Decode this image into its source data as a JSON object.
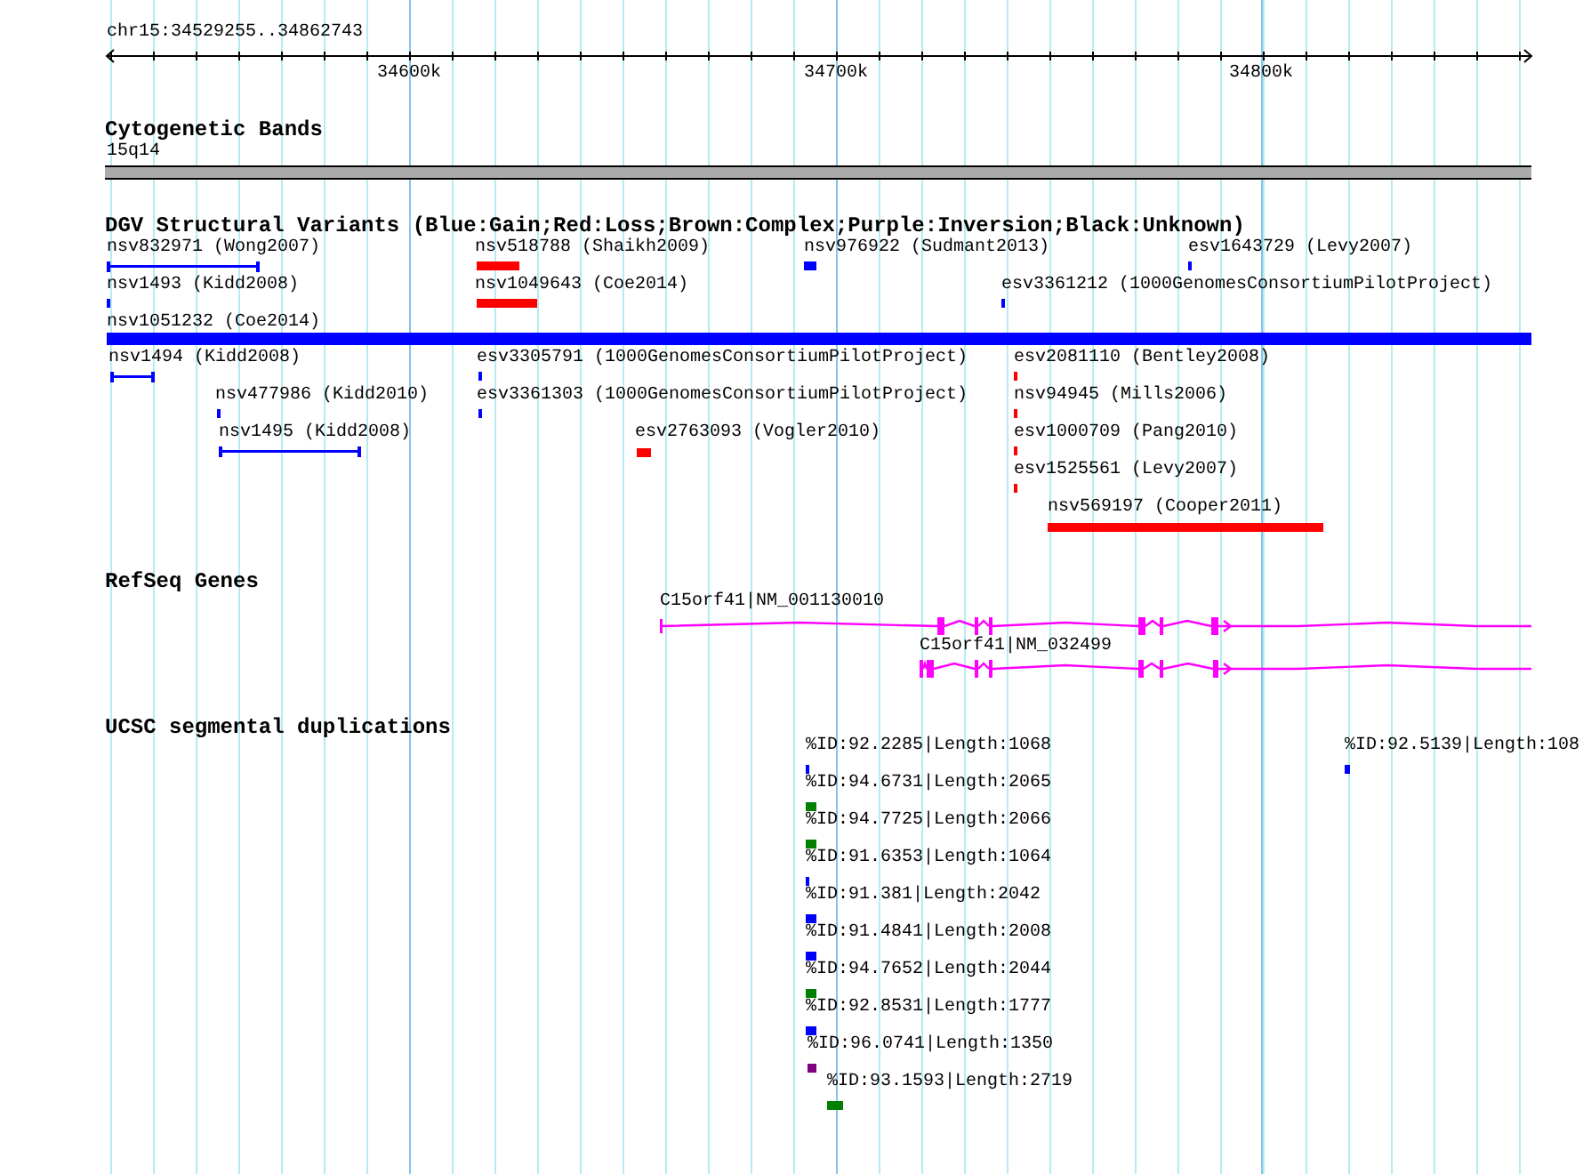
{
  "ruler": {
    "range_label": "chr15:34529255..34862743",
    "ticks": [
      {
        "label": "34600k"
      },
      {
        "label": "34700k"
      },
      {
        "label": "34800k"
      }
    ]
  },
  "cytogenetic_bands": {
    "title": "Cytogenetic Bands",
    "band_label": "15q14"
  },
  "dgv": {
    "title": "DGV Structural Variants (Blue:Gain;Red:Loss;Brown:Complex;Purple:Inversion;Black:Unknown)",
    "features": [
      {
        "label": "nsv832971 (Wong2007)",
        "color": "#0000ff"
      },
      {
        "label": "nsv518788 (Shaikh2009)",
        "color": "#ff0000"
      },
      {
        "label": "nsv976922 (Sudmant2013)",
        "color": "#0000ff"
      },
      {
        "label": "esv1643729 (Levy2007)",
        "color": "#0000ff"
      },
      {
        "label": "nsv1493 (Kidd2008)",
        "color": "#0000ff"
      },
      {
        "label": "nsv1049643 (Coe2014)",
        "color": "#ff0000"
      },
      {
        "label": "esv3361212 (1000GenomesConsortiumPilotProject)",
        "color": "#0000ff"
      },
      {
        "label": "nsv1051232 (Coe2014)",
        "color": "#0000ff"
      },
      {
        "label": "nsv1494 (Kidd2008)",
        "color": "#0000ff"
      },
      {
        "label": "esv3305791 (1000GenomesConsortiumPilotProject)",
        "color": "#0000ff"
      },
      {
        "label": "esv2081110 (Bentley2008)",
        "color": "#ff0000"
      },
      {
        "label": "nsv477986 (Kidd2010)",
        "color": "#0000ff"
      },
      {
        "label": "esv3361303 (1000GenomesConsortiumPilotProject)",
        "color": "#0000ff"
      },
      {
        "label": "nsv94945 (Mills2006)",
        "color": "#ff0000"
      },
      {
        "label": "nsv1495 (Kidd2008)",
        "color": "#0000ff"
      },
      {
        "label": "esv2763093 (Vogler2010)",
        "color": "#ff0000"
      },
      {
        "label": "esv1000709 (Pang2010)",
        "color": "#ff0000"
      },
      {
        "label": "esv1525561 (Levy2007)",
        "color": "#ff0000"
      },
      {
        "label": "nsv569197 (Cooper2011)",
        "color": "#ff0000"
      }
    ]
  },
  "refseq": {
    "title": "RefSeq Genes",
    "transcripts": [
      {
        "label": "C15orf41|NM_001130010"
      },
      {
        "label": "C15orf41|NM_032499"
      }
    ]
  },
  "segdups": {
    "title": "UCSC segmental duplications",
    "features": [
      {
        "label": "%ID:92.2285|Length:1068",
        "color": "#0000ff"
      },
      {
        "label": "%ID:92.5139|Length:108",
        "color": "#0000ff"
      },
      {
        "label": "%ID:94.6731|Length:2065",
        "color": "#008000"
      },
      {
        "label": "%ID:94.7725|Length:2066",
        "color": "#008000"
      },
      {
        "label": "%ID:91.6353|Length:1064",
        "color": "#0000ff"
      },
      {
        "label": "%ID:91.381|Length:2042",
        "color": "#0000ff"
      },
      {
        "label": "%ID:91.4841|Length:2008",
        "color": "#0000ff"
      },
      {
        "label": "%ID:94.7652|Length:2044",
        "color": "#008000"
      },
      {
        "label": "%ID:92.8531|Length:1777",
        "color": "#0000ff"
      },
      {
        "label": "%ID:96.0741|Length:1350",
        "color": "#800080"
      },
      {
        "label": "%ID:93.1593|Length:2719",
        "color": "#008000"
      }
    ]
  }
}
